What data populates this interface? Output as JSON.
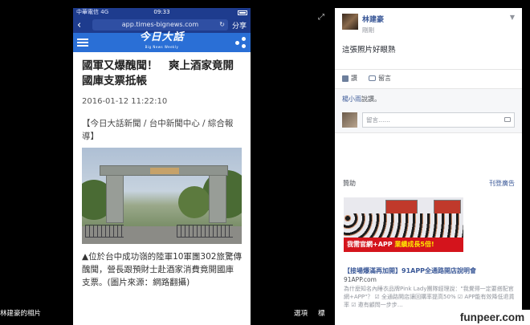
{
  "phone": {
    "status": {
      "carrier": "中華電信",
      "network": "4G",
      "time": "09:33"
    },
    "browser": {
      "url": "app.times-bignews.com",
      "share_label": "分享"
    },
    "site": {
      "logo": "今日大話",
      "logo_sub": "Big News Weekly"
    },
    "article": {
      "headline": "國軍又爆醜聞！　爽上酒家竟開國庫支票抵帳",
      "date": "2016-01-12 11:22:10",
      "source": "【今日大話新聞 / 台中新聞中心 / 綜合報導】",
      "caption": "▲位於台中成功嶺的陸軍10軍團302旅驚傳醜聞，營長跟預財士赴酒家消費竟開國庫支票。(圖片來源：網路翻攝)"
    }
  },
  "bottom_bar": {
    "owner_label": "林建豪的相片",
    "options_label": "選項",
    "tag_label": "標"
  },
  "facebook": {
    "post": {
      "author": "林建豪",
      "timestamp": "剛剛",
      "text": "這張照片好眼熟"
    },
    "actions": {
      "like": "讚",
      "comment": "留言"
    },
    "likes_text_name": "楊小雨",
    "likes_text_suffix": "說讚。",
    "comment_placeholder": "留言……",
    "sponsored": {
      "label": "贊助",
      "create_ad": "刊登廣告"
    },
    "ad": {
      "banner": "我需官網+APP",
      "banner_highlight": "業績成長5倍!",
      "title": "【接場爆滿再加開】91APP全通路開店說明會",
      "domain": "91APP.com",
      "description": "為什麼知名內睡衣品牌Pink Lady團隊經理說：\"我覺得一定要搭配官網+APP\"？ ☑ 全通路開店讓回購率提高50% ☑ APP能有效降低退貨率 ☑ 邀有顧問一步步…"
    }
  },
  "watermark": "funpeer.com"
}
